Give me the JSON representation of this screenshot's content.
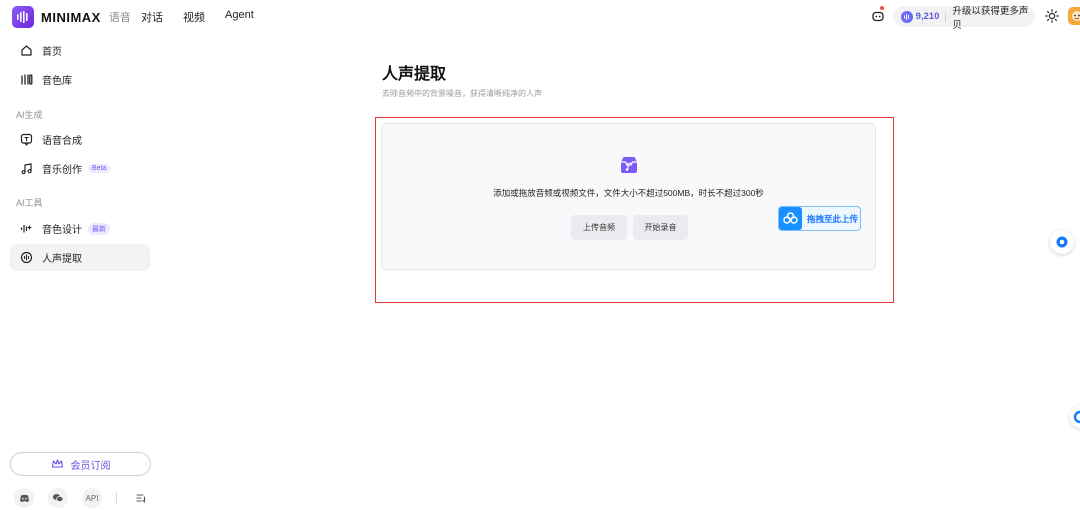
{
  "header": {
    "brand": "MINIMAX",
    "brand_section": "语音",
    "nav": [
      "对话",
      "视频",
      "Agent"
    ],
    "credits": "9,210",
    "upgrade_text": "升级以获得更多声贝",
    "icons": [
      "robot-icon",
      "credit-coin-icon",
      "sun-icon",
      "avatar"
    ]
  },
  "sidebar": {
    "items": [
      {
        "label": "首页",
        "icon": "home-icon"
      },
      {
        "label": "音色库",
        "icon": "voice-library-icon"
      }
    ],
    "group_ai_generate": {
      "title": "AI生成",
      "items": [
        {
          "label": "语音合成",
          "icon": "tts-icon"
        },
        {
          "label": "音乐创作",
          "icon": "music-note-icon",
          "badge": "Beta"
        }
      ]
    },
    "group_ai_tools": {
      "title": "AI工具",
      "items": [
        {
          "label": "音色设计",
          "icon": "voice-design-icon",
          "badge": "最新"
        },
        {
          "label": "人声提取",
          "icon": "vocal-extract-icon",
          "active": true
        }
      ]
    },
    "member_label": "会员订阅",
    "footer": {
      "api_label": "API",
      "icons": [
        "discord-icon",
        "wechat-icon",
        "api-icon",
        "changelog-icon"
      ]
    }
  },
  "main": {
    "title": "人声提取",
    "subtitle": "去除音频中的背景噪音，获得清晰纯净的人声",
    "upload_text": "添加或拖放音频或视频文件，文件大小不超过500MB，时长不超过300秒",
    "upload_button": "上传音频",
    "record_button": "开始录音",
    "drag_hint": "拖拽至此上传"
  },
  "colors": {
    "brand": "#7c5cf6",
    "accent_blue": "#1677ff",
    "highlight_frame": "#e53935"
  }
}
